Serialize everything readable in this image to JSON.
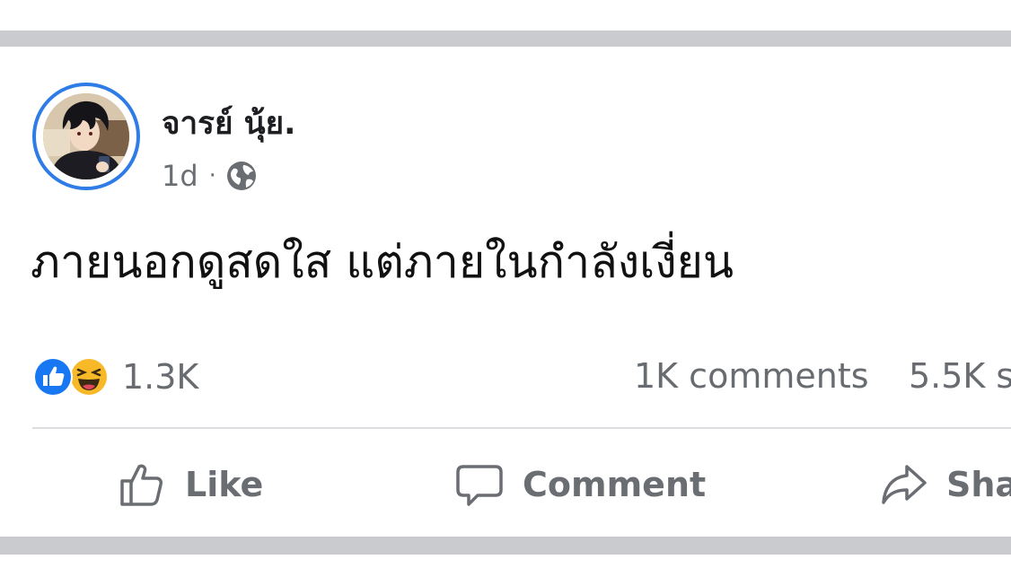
{
  "post": {
    "author_name": "จารย์ นุ้ย.",
    "timestamp": "1d",
    "separator": "·",
    "privacy_icon": "globe-icon",
    "text": "ภายนอกดูสดใส แต่ภายในกำลังเงี่ยน"
  },
  "engagement": {
    "reaction_icons": [
      "like-reaction-icon",
      "haha-reaction-icon"
    ],
    "reactions_count": "1.3K",
    "comments_count": "1K comments",
    "shares_count": "5.5K s"
  },
  "actions": {
    "like_label": "Like",
    "comment_label": "Comment",
    "share_label": "Sha"
  },
  "colors": {
    "avatar_ring": "#2f7ce6",
    "like_blue": "#1877f2",
    "haha_yellow": "#f7b928",
    "muted_text": "#65676b",
    "separator_band": "#cacbcf"
  }
}
